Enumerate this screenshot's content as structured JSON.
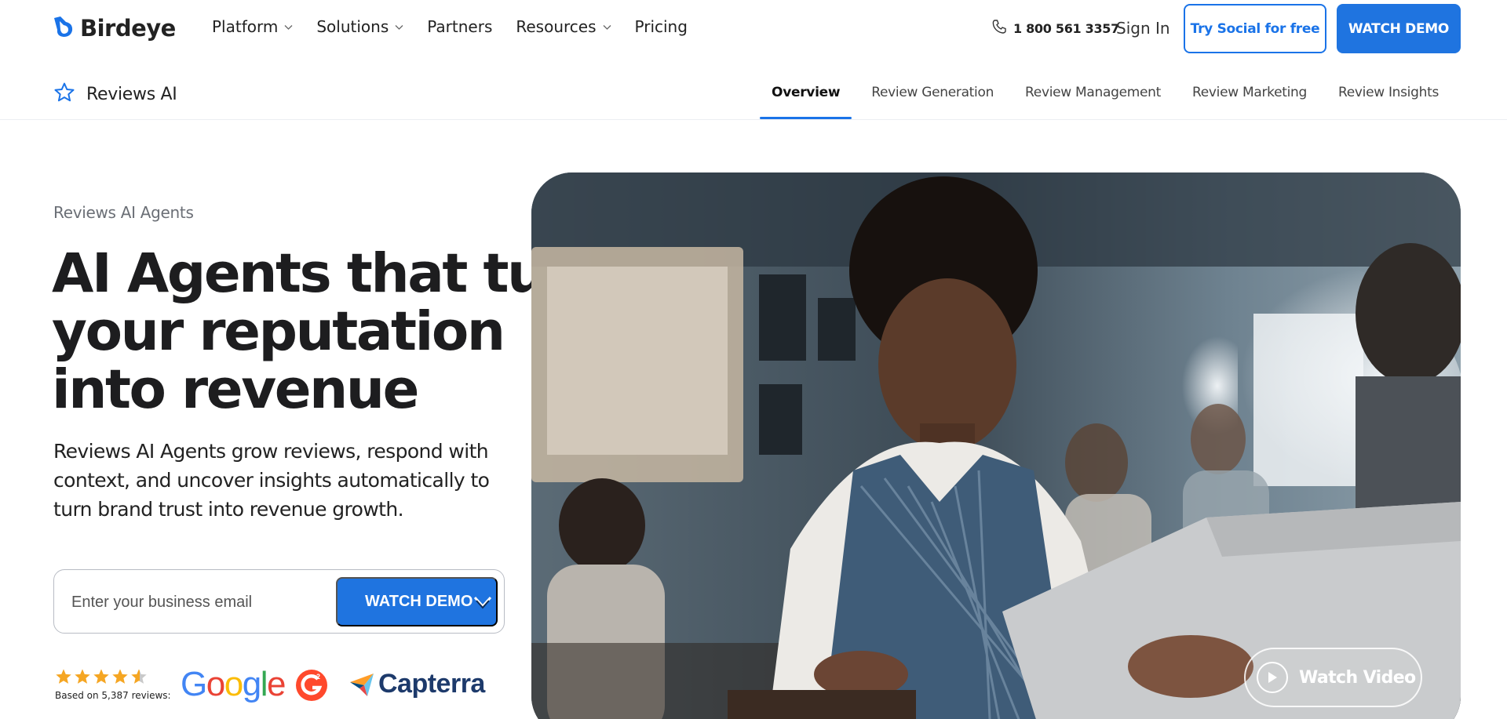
{
  "header": {
    "brand": "Birdeye",
    "nav": [
      {
        "label": "Platform",
        "dropdown": true
      },
      {
        "label": "Solutions",
        "dropdown": true
      },
      {
        "label": "Partners",
        "dropdown": false
      },
      {
        "label": "Resources",
        "dropdown": true
      },
      {
        "label": "Pricing",
        "dropdown": false
      }
    ],
    "phone": "1 800 561 3357",
    "sign_in": "Sign In",
    "try_social": "Try Social for free",
    "watch_demo": "WATCH DEMO"
  },
  "subnav": {
    "product": "Reviews AI",
    "tabs": [
      {
        "label": "Overview",
        "active": true
      },
      {
        "label": "Review Generation",
        "active": false
      },
      {
        "label": "Review Management",
        "active": false
      },
      {
        "label": "Review Marketing",
        "active": false
      },
      {
        "label": "Review Insights",
        "active": false
      }
    ]
  },
  "hero": {
    "eyebrow": "Reviews AI Agents",
    "headline_lines": [
      "AI Agents that turn",
      "your reputation",
      "into revenue"
    ],
    "subcopy": "Reviews AI Agents grow reviews, respond with context, and uncover insights automatically to turn brand trust into revenue growth.",
    "email_placeholder": "Enter your business email",
    "email_value": "",
    "cta": "WATCH DEMO",
    "rating_text": "Based on 5,387 reviews:",
    "stars": 4.5,
    "review_sites": [
      "Google",
      "G2",
      "Capterra"
    ],
    "video_label": "Watch Video"
  },
  "colors": {
    "brand_blue": "#1f74e0",
    "text_dark": "#1d1d1f",
    "muted": "#6b6f76",
    "star": "#f5a623"
  },
  "icons": {
    "logo": "birdeye-logo-icon",
    "phone": "phone-icon",
    "product": "star-outline-icon",
    "dropdown": "chevron-down-icon",
    "play": "play-icon"
  }
}
